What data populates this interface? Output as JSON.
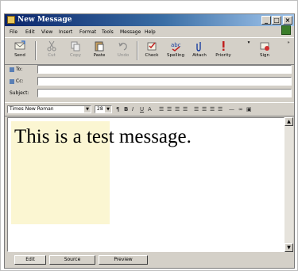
{
  "window": {
    "title": "New Message",
    "controls": [
      "_",
      "□",
      "×"
    ]
  },
  "menu": [
    "File",
    "Edit",
    "View",
    "Insert",
    "Format",
    "Tools",
    "Message",
    "Help"
  ],
  "toolbar": {
    "buttons": [
      {
        "label": "Send",
        "icon": "send-icon",
        "enabled": true
      },
      {
        "label": "Cut",
        "icon": "cut-icon",
        "enabled": false
      },
      {
        "label": "Copy",
        "icon": "copy-icon",
        "enabled": false
      },
      {
        "label": "Paste",
        "icon": "paste-icon",
        "enabled": true
      },
      {
        "label": "Undo",
        "icon": "undo-icon",
        "enabled": false
      },
      {
        "label": "Check",
        "icon": "check-names-icon",
        "enabled": true
      },
      {
        "label": "Spelling",
        "icon": "spelling-icon",
        "enabled": true
      },
      {
        "label": "Attach",
        "icon": "attach-icon",
        "enabled": true
      },
      {
        "label": "Priority",
        "icon": "priority-icon",
        "enabled": true
      },
      {
        "label": "Sign",
        "icon": "sign-icon",
        "enabled": true
      }
    ]
  },
  "header": {
    "to_label": "To:",
    "cc_label": "Cc:",
    "subject_label": "Subject:",
    "to_value": "",
    "cc_value": "",
    "subject_value": ""
  },
  "format": {
    "font": "Times New Roman",
    "size": "28",
    "buttons": [
      "B",
      "I",
      "U",
      "A"
    ]
  },
  "body": {
    "text": "This is a test message."
  },
  "tabs": [
    "Edit",
    "Source",
    "Preview"
  ],
  "colors": {
    "titlebar_start": "#0a246a",
    "titlebar_end": "#a6caf0",
    "chrome": "#d4d0c8",
    "highlight": "#fbf6d2"
  }
}
